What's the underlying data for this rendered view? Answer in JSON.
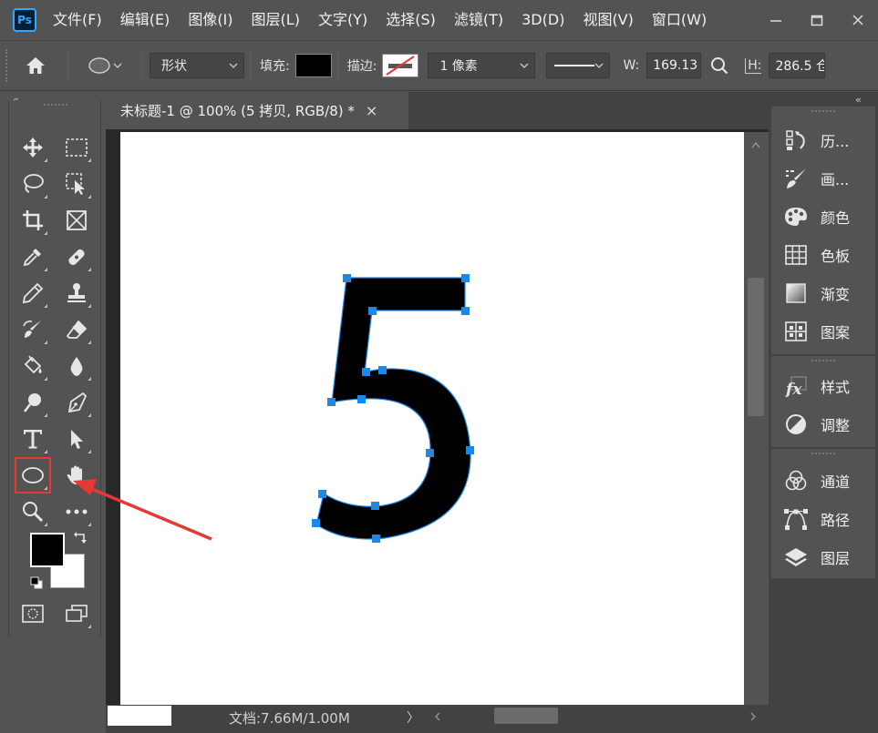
{
  "app": {
    "logo": "Ps"
  },
  "menu": [
    "文件(F)",
    "编辑(E)",
    "图像(I)",
    "图层(L)",
    "文字(Y)",
    "选择(S)",
    "滤镜(T)",
    "3D(D)",
    "视图(V)",
    "窗口(W)"
  ],
  "options": {
    "mode": "形状",
    "fill_label": "填充:",
    "stroke_label": "描边:",
    "stroke_width": "1 像素",
    "w_label": "W:",
    "w_value": "169.13",
    "h_label": "H:",
    "h_value": "286.5 仓"
  },
  "document": {
    "tab_title": "未标题-1 @ 100% (5 拷贝, RGB/8) *",
    "tab_close": "×",
    "glyph": "5"
  },
  "status": {
    "text": "文档:7.66M/1.00M",
    "arrow": "〉"
  },
  "panel_collapse": "‹‹",
  "right_panel": {
    "group1": [
      "历...",
      "画...",
      "颜色",
      "色板",
      "渐变",
      "图案"
    ],
    "group2": [
      "样式",
      "调整"
    ],
    "group3": [
      "通道",
      "路径",
      "图层"
    ]
  },
  "colors": {
    "accent": "#1e88e5",
    "annotation": "#e53935",
    "fill": "#000000"
  }
}
